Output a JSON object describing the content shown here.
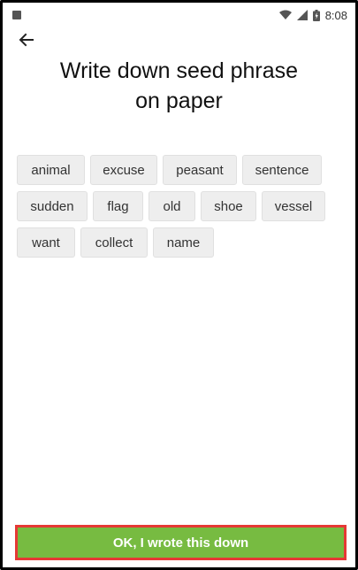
{
  "status_bar": {
    "time": "8:08",
    "icons": [
      "notification-icon",
      "wifi-icon",
      "signal-icon",
      "battery-icon"
    ]
  },
  "header": {
    "back_icon": "back-arrow-icon"
  },
  "title": {
    "line1": "Write down seed phrase",
    "line2": "on paper"
  },
  "words": [
    [
      "animal",
      "excuse",
      "peasant",
      "sentence"
    ],
    [
      "sudden",
      "flag",
      "old",
      "shoe",
      "vessel"
    ],
    [
      "want",
      "collect",
      "name"
    ]
  ],
  "cta": {
    "label": "OK, I wrote this down",
    "background": "#77bb41",
    "border": "#e53935"
  }
}
